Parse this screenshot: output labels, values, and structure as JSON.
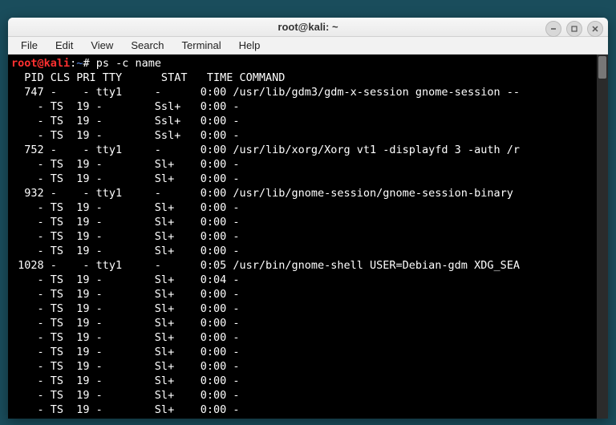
{
  "window": {
    "title": "root@kali: ~"
  },
  "menubar": {
    "items": [
      "File",
      "Edit",
      "View",
      "Search",
      "Terminal",
      "Help"
    ]
  },
  "prompt": {
    "user": "root",
    "at": "@",
    "host": "kali",
    "colon": ":",
    "path": "~",
    "hash": "#",
    "command": "ps -c name"
  },
  "header": "  PID CLS PRI TTY      STAT   TIME COMMAND",
  "rows": [
    {
      "pid": "  747",
      "cls": "-",
      "pri": "  -",
      "tty": "tty1   ",
      "stat": "-    ",
      "time": "0:00",
      "cmd": "/usr/lib/gdm3/gdm-x-session gnome-session --"
    },
    {
      "pid": "    -",
      "cls": "TS",
      "pri": " 19",
      "tty": "-      ",
      "stat": "Ssl+ ",
      "time": "0:00",
      "cmd": "-"
    },
    {
      "pid": "    -",
      "cls": "TS",
      "pri": " 19",
      "tty": "-      ",
      "stat": "Ssl+ ",
      "time": "0:00",
      "cmd": "-"
    },
    {
      "pid": "    -",
      "cls": "TS",
      "pri": " 19",
      "tty": "-      ",
      "stat": "Ssl+ ",
      "time": "0:00",
      "cmd": "-"
    },
    {
      "pid": "  752",
      "cls": "-",
      "pri": "  -",
      "tty": "tty1   ",
      "stat": "-    ",
      "time": "0:00",
      "cmd": "/usr/lib/xorg/Xorg vt1 -displayfd 3 -auth /r"
    },
    {
      "pid": "    -",
      "cls": "TS",
      "pri": " 19",
      "tty": "-      ",
      "stat": "Sl+  ",
      "time": "0:00",
      "cmd": "-"
    },
    {
      "pid": "    -",
      "cls": "TS",
      "pri": " 19",
      "tty": "-      ",
      "stat": "Sl+  ",
      "time": "0:00",
      "cmd": "-"
    },
    {
      "pid": "  932",
      "cls": "-",
      "pri": "  -",
      "tty": "tty1   ",
      "stat": "-    ",
      "time": "0:00",
      "cmd": "/usr/lib/gnome-session/gnome-session-binary "
    },
    {
      "pid": "    -",
      "cls": "TS",
      "pri": " 19",
      "tty": "-      ",
      "stat": "Sl+  ",
      "time": "0:00",
      "cmd": "-"
    },
    {
      "pid": "    -",
      "cls": "TS",
      "pri": " 19",
      "tty": "-      ",
      "stat": "Sl+  ",
      "time": "0:00",
      "cmd": "-"
    },
    {
      "pid": "    -",
      "cls": "TS",
      "pri": " 19",
      "tty": "-      ",
      "stat": "Sl+  ",
      "time": "0:00",
      "cmd": "-"
    },
    {
      "pid": "    -",
      "cls": "TS",
      "pri": " 19",
      "tty": "-      ",
      "stat": "Sl+  ",
      "time": "0:00",
      "cmd": "-"
    },
    {
      "pid": " 1028",
      "cls": "-",
      "pri": "  -",
      "tty": "tty1   ",
      "stat": "-    ",
      "time": "0:05",
      "cmd": "/usr/bin/gnome-shell USER=Debian-gdm XDG_SEA"
    },
    {
      "pid": "    -",
      "cls": "TS",
      "pri": " 19",
      "tty": "-      ",
      "stat": "Sl+  ",
      "time": "0:04",
      "cmd": "-"
    },
    {
      "pid": "    -",
      "cls": "TS",
      "pri": " 19",
      "tty": "-      ",
      "stat": "Sl+  ",
      "time": "0:00",
      "cmd": "-"
    },
    {
      "pid": "    -",
      "cls": "TS",
      "pri": " 19",
      "tty": "-      ",
      "stat": "Sl+  ",
      "time": "0:00",
      "cmd": "-"
    },
    {
      "pid": "    -",
      "cls": "TS",
      "pri": " 19",
      "tty": "-      ",
      "stat": "Sl+  ",
      "time": "0:00",
      "cmd": "-"
    },
    {
      "pid": "    -",
      "cls": "TS",
      "pri": " 19",
      "tty": "-      ",
      "stat": "Sl+  ",
      "time": "0:00",
      "cmd": "-"
    },
    {
      "pid": "    -",
      "cls": "TS",
      "pri": " 19",
      "tty": "-      ",
      "stat": "Sl+  ",
      "time": "0:00",
      "cmd": "-"
    },
    {
      "pid": "    -",
      "cls": "TS",
      "pri": " 19",
      "tty": "-      ",
      "stat": "Sl+  ",
      "time": "0:00",
      "cmd": "-"
    },
    {
      "pid": "    -",
      "cls": "TS",
      "pri": " 19",
      "tty": "-      ",
      "stat": "Sl+  ",
      "time": "0:00",
      "cmd": "-"
    },
    {
      "pid": "    -",
      "cls": "TS",
      "pri": " 19",
      "tty": "-      ",
      "stat": "Sl+  ",
      "time": "0:00",
      "cmd": "-"
    },
    {
      "pid": "    -",
      "cls": "TS",
      "pri": " 19",
      "tty": "-      ",
      "stat": "Sl+  ",
      "time": "0:00",
      "cmd": "-"
    }
  ]
}
